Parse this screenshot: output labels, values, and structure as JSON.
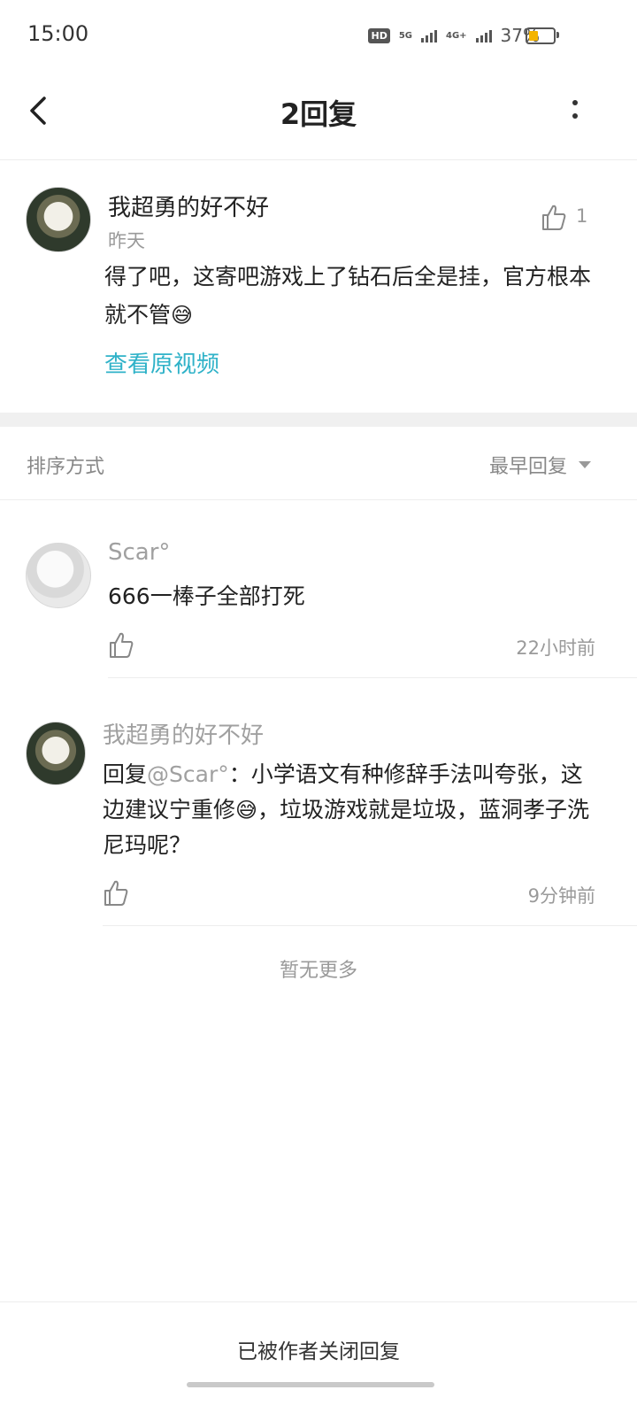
{
  "status_bar": {
    "time": "15:00",
    "hd_label": "HD",
    "net1": "5G",
    "net2": "4G+",
    "battery_percent": "37%",
    "battery_level": 0.37,
    "battery_color": "#f4b400"
  },
  "header": {
    "title": "2回复",
    "back_icon": "chevron-left-icon",
    "more_icon": "more-vertical-icon"
  },
  "main_comment": {
    "username": "我超勇的好不好",
    "time": "昨天",
    "like_count": "1",
    "text_before_emoji": "得了吧，这寄吧游戏上了钻石后全是挂，官方根本就不管",
    "emoji": "😅",
    "view_video_label": "查看原视频",
    "link_color": "#2fb2c8"
  },
  "sort": {
    "label": "排序方式",
    "value": "最早回复"
  },
  "replies": [
    {
      "username": "Scar°",
      "text": "666一棒子全部打死",
      "time": "22小时前"
    },
    {
      "username": "我超勇的好不好",
      "reply_prefix": "回复",
      "mention": "@Scar°",
      "text_part1": "：小学语文有种修辞手法叫夸张，这边建议宁重修",
      "emoji": "😅",
      "text_part2": "，垃圾游戏就是垃圾，蓝洞孝子洗尼玛呢？",
      "time": "9分钟前"
    }
  ],
  "no_more": "暂无更多",
  "footer": {
    "closed_notice": "已被作者关闭回复"
  }
}
